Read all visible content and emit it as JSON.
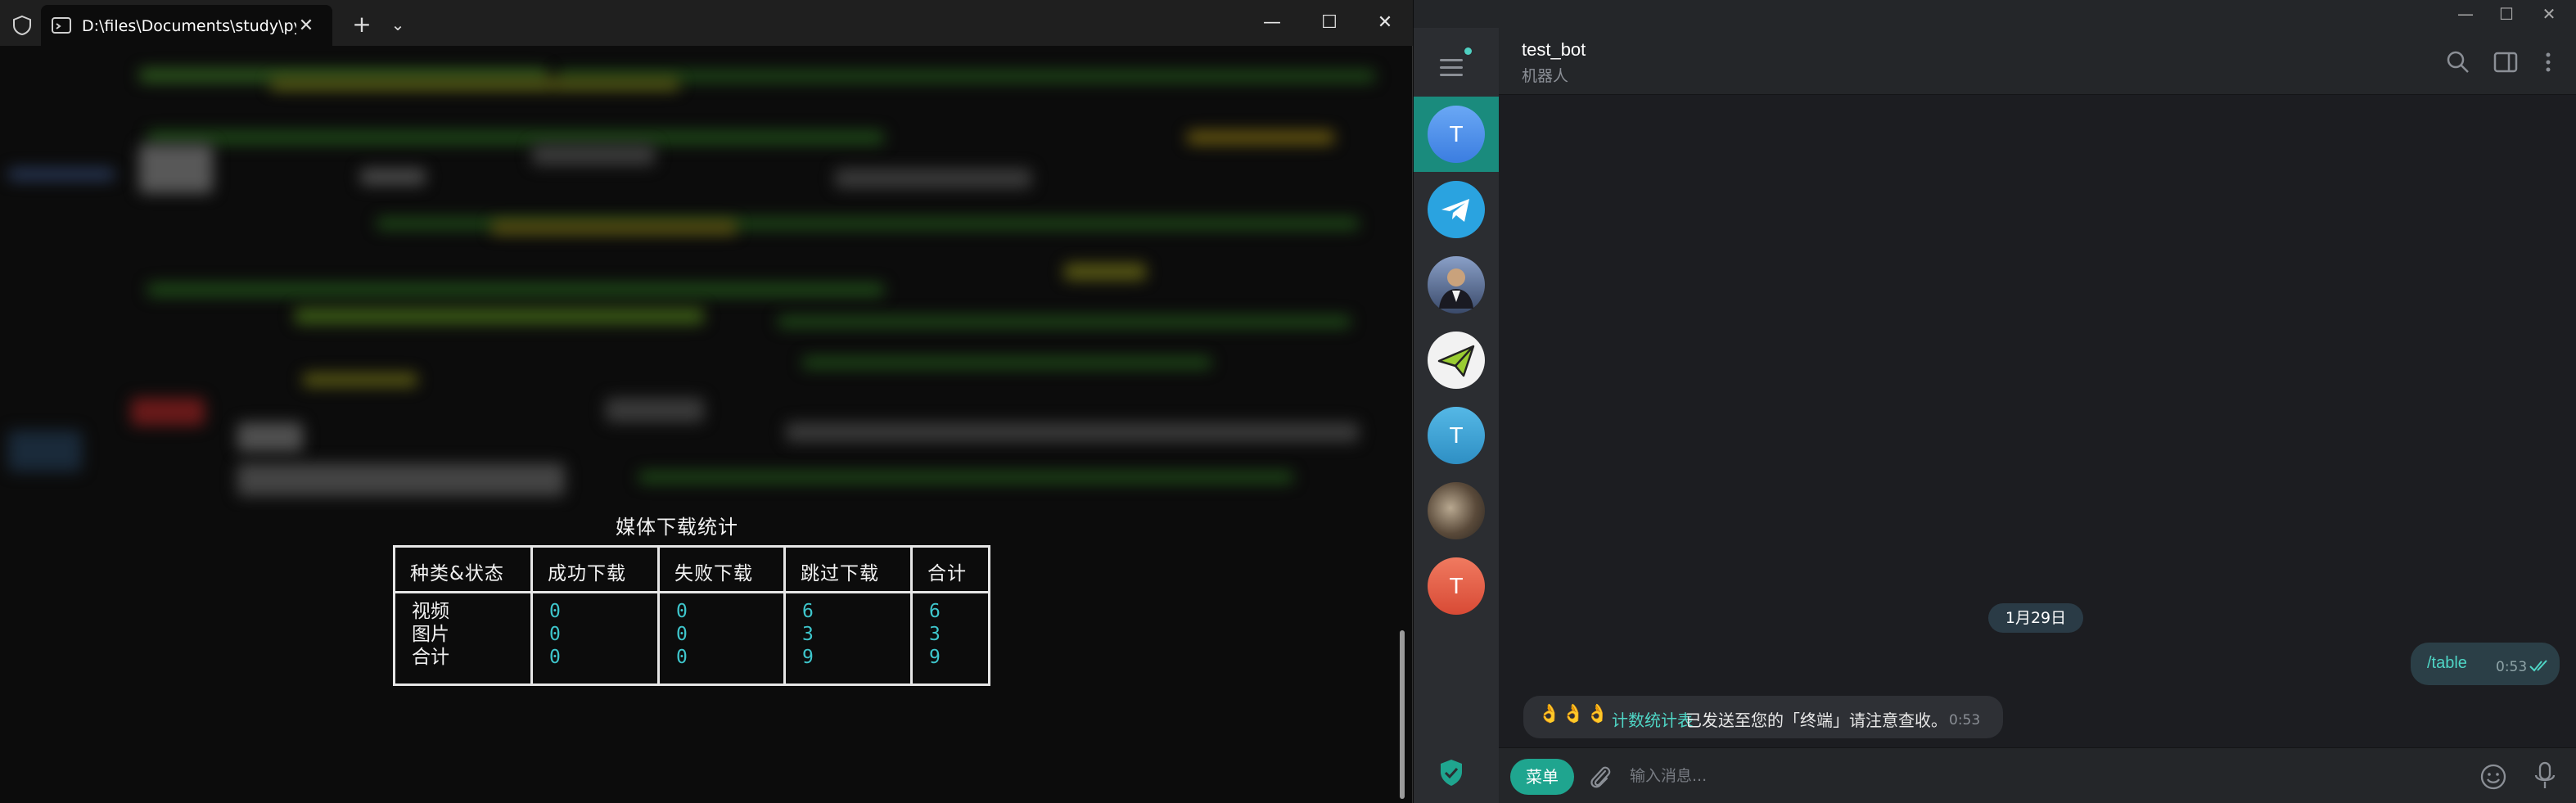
{
  "terminal": {
    "tab_title": "D:\\files\\Documents\\study\\py",
    "tab_close": "✕",
    "new_tab": "+",
    "dropdown": "⌄",
    "controls": {
      "minimize": "—",
      "maximize": "☐",
      "close": "✕"
    },
    "output": {
      "title": "媒体下载统计",
      "headers": [
        "种类&状态",
        "成功下载",
        "失败下载",
        "跳过下载",
        "合计"
      ],
      "rows": [
        [
          "视频",
          "0",
          "0",
          "6",
          "6"
        ],
        [
          "图片",
          "0",
          "0",
          "3",
          "3"
        ],
        [
          "合计",
          "0",
          "0",
          "9",
          "9"
        ]
      ]
    }
  },
  "telegram": {
    "controls": {
      "minimize": "—",
      "maximize": "☐",
      "close": "✕"
    },
    "sidebar": {
      "folders": [
        {
          "letter": "T",
          "color": "#4a8fe8",
          "active": true
        },
        {
          "letter": "",
          "icon": "telegram-plane-icon",
          "color": "#2aa3e0"
        },
        {
          "letter": "",
          "icon": "person-photo-icon",
          "color": "#5a6a8a"
        },
        {
          "letter": "",
          "icon": "paper-plane-icon",
          "color": "#f0f0f0"
        },
        {
          "letter": "T",
          "color": "#3aa7d6"
        },
        {
          "letter": "",
          "icon": "photo-avatar-icon",
          "color": "#6b5a4a"
        },
        {
          "letter": "T",
          "color": "#e65a45"
        }
      ]
    },
    "header": {
      "name": "test_bot",
      "status": "机器人"
    },
    "chat": {
      "date": "1月29日",
      "outgoing": {
        "text": "/table",
        "time": "0:53"
      },
      "incoming": {
        "emoji": "👌👌👌",
        "link": "计数统计表",
        "text": "已发送至您的「终端」请注意查收。",
        "time": "0:53"
      }
    },
    "composer": {
      "menu_label": "菜单",
      "placeholder": "输入消息..."
    }
  }
}
